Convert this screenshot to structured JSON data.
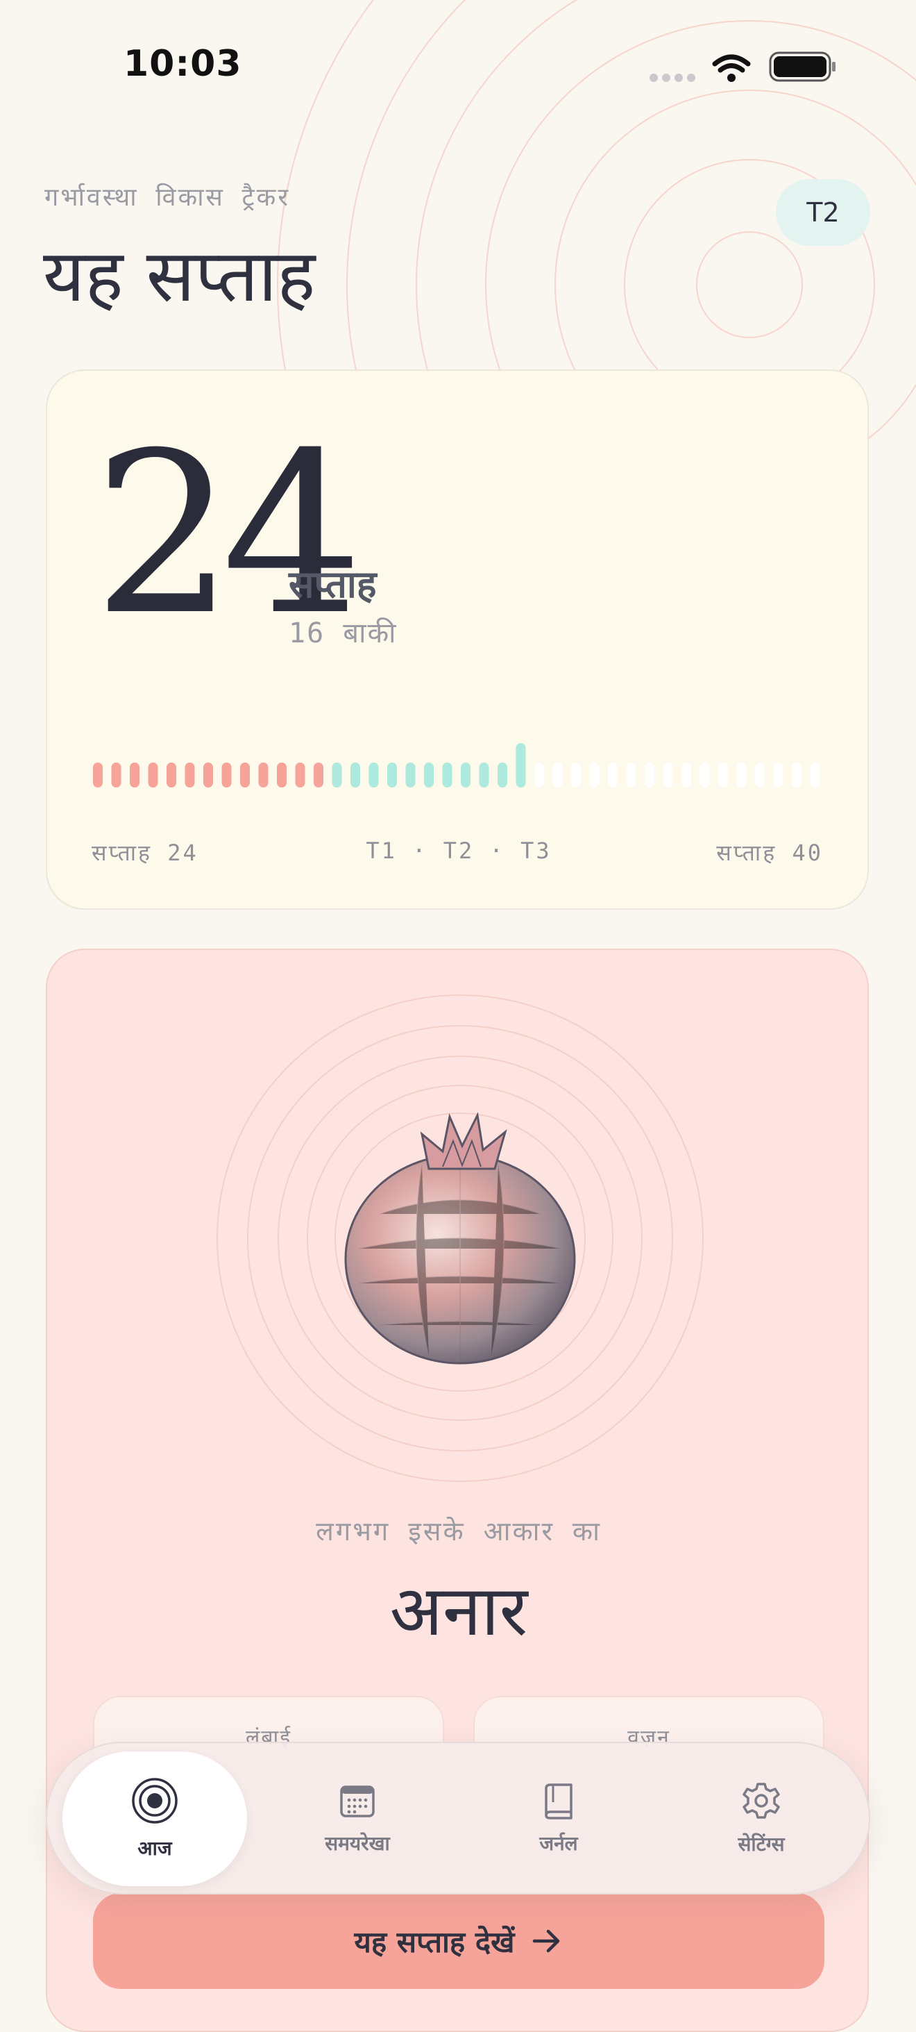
{
  "status_bar": {
    "time": "10:03"
  },
  "header": {
    "eyebrow": "गर्भावस्था विकास ट्रैकर",
    "title": "यह सप्ताह",
    "trimester_badge": "T2"
  },
  "week_card": {
    "week_number": "24",
    "week_label": "सप्ताह",
    "remaining": "16 बाकी",
    "progress": {
      "current_week": 24,
      "total_weeks": 40,
      "t1_color": "#f6a49a",
      "t2_color": "#aee9dd"
    },
    "footer_left": "सप्ताह 24",
    "footer_center": "T1 · T2 · T3",
    "footer_right": "सप्ताह 40"
  },
  "fruit_card": {
    "caption": "लगभग इसके आकार का",
    "fruit_name": "अनार",
    "fruit_icon": "pomegranate-illustration",
    "length_label": "लंबाई",
    "weight_label": "वज़न",
    "cta_label": "यह सप्ताह देखें",
    "cta_icon": "arrow-right-icon"
  },
  "bottom_nav": {
    "items": [
      {
        "label": "आज",
        "icon": "target-icon",
        "active": true
      },
      {
        "label": "समयरेखा",
        "icon": "calendar-icon",
        "active": false
      },
      {
        "label": "जर्नल",
        "icon": "book-icon",
        "active": false
      },
      {
        "label": "सेटिंग्स",
        "icon": "gear-icon",
        "active": false
      }
    ]
  },
  "colors": {
    "accent": "#f6a49a",
    "mint": "#aee9dd",
    "background": "#faf6f0"
  }
}
